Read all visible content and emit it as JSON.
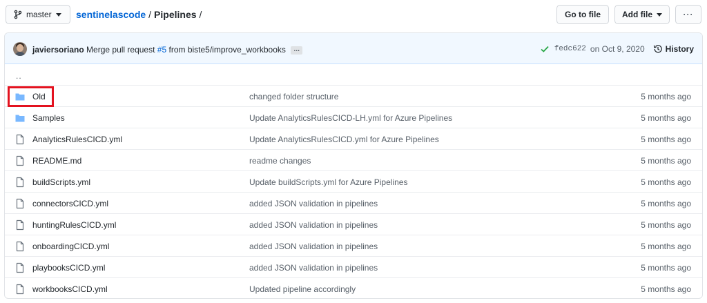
{
  "branch": {
    "label": "master"
  },
  "breadcrumb": {
    "repo": "sentinelascode",
    "separator1": "/",
    "folder": "Pipelines",
    "separator2": "/"
  },
  "actions": {
    "goto_file": "Go to file",
    "add_file": "Add file",
    "more": "···"
  },
  "commit": {
    "author": "javiersoriano",
    "message_prefix": "Merge pull request",
    "pr_number": "#5",
    "message_suffix": "from biste5/improve_workbooks",
    "ellipsis": "…",
    "sha": "fedc622",
    "date": "on Oct 9, 2020",
    "history_label": "History"
  },
  "parent_dir": "..",
  "rows": [
    {
      "type": "folder",
      "name": "Old",
      "message": "changed folder structure",
      "age": "5 months ago"
    },
    {
      "type": "folder",
      "name": "Samples",
      "message": "Update AnalyticsRulesCICD-LH.yml for Azure Pipelines",
      "age": "5 months ago"
    },
    {
      "type": "file",
      "name": "AnalyticsRulesCICD.yml",
      "message": "Update AnalyticsRulesCICD.yml for Azure Pipelines",
      "age": "5 months ago"
    },
    {
      "type": "file",
      "name": "README.md",
      "message": "readme changes",
      "age": "5 months ago"
    },
    {
      "type": "file",
      "name": "buildScripts.yml",
      "message": "Update buildScripts.yml for Azure Pipelines",
      "age": "5 months ago"
    },
    {
      "type": "file",
      "name": "connectorsCICD.yml",
      "message": "added JSON validation in pipelines",
      "age": "5 months ago"
    },
    {
      "type": "file",
      "name": "huntingRulesCICD.yml",
      "message": "added JSON validation in pipelines",
      "age": "5 months ago"
    },
    {
      "type": "file",
      "name": "onboardingCICD.yml",
      "message": "added JSON validation in pipelines",
      "age": "5 months ago"
    },
    {
      "type": "file",
      "name": "playbooksCICD.yml",
      "message": "added JSON validation in pipelines",
      "age": "5 months ago"
    },
    {
      "type": "file",
      "name": "workbooksCICD.yml",
      "message": "Updated pipeline accordingly",
      "age": "5 months ago"
    }
  ],
  "colors": {
    "link": "#0366d6",
    "folder": "#79b8ff",
    "highlight": "#e3121f",
    "commit_bg": "#f1f8ff",
    "success": "#28a745"
  }
}
